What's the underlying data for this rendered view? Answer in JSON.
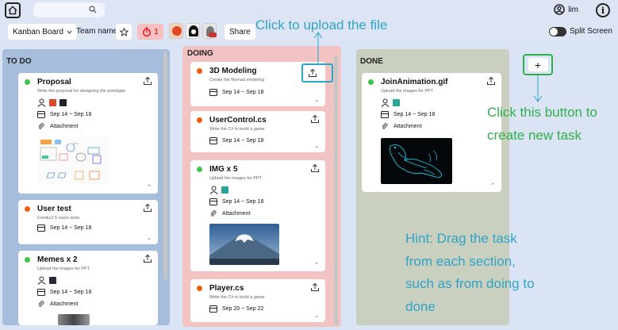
{
  "topbar": {
    "user_name": "lim",
    "info_symbol": "i"
  },
  "toolbar": {
    "board_select": "Kanban Board",
    "team_name": "Team name",
    "star_icon": "star-outline-icon",
    "timer_count": "1",
    "share_label": "Share",
    "split_screen_label": "Split Screen"
  },
  "columns": {
    "todo": {
      "title": "TO DO",
      "cards": [
        {
          "title": "Proposal",
          "desc": "Write the proposal for designing the prototype",
          "dates": "Sep 14 ~ Sep 18",
          "attachment": "Attachment",
          "status_color": "#3cc44b"
        },
        {
          "title": "User test",
          "desc": "Conduct 5 users tests",
          "dates": "Sep 14 ~ Sep 18",
          "status_color": "#f05a0b"
        },
        {
          "title": "Memes x 2",
          "desc": "Upload the images for PPT",
          "dates": "Sep 14 ~ Sep 18",
          "attachment": "Attachment",
          "status_color": "#3cc44b"
        }
      ]
    },
    "doing": {
      "title": "DOING",
      "cards": [
        {
          "title": "3D Modeling",
          "desc": "Create the Nomad modeling",
          "dates": "Sep 14 ~ Sep 18",
          "status_color": "#f05a0b"
        },
        {
          "title": "UserControl.cs",
          "desc": "Write the C# to build a game",
          "dates": "Sep 14 ~ Sep 18",
          "status_color": "#f05a0b"
        },
        {
          "title": "IMG x 5",
          "desc": "Upload the images for PPT",
          "dates": "Sep 14 ~ Sep 18",
          "attachment": "Attachment",
          "status_color": "#3cc44b"
        },
        {
          "title": "Player.cs",
          "desc": "Write the C# to build a game",
          "dates": "Sep 20 ~ Sep 22",
          "status_color": "#f05a0b"
        }
      ]
    },
    "done": {
      "title": "DONE",
      "cards": [
        {
          "title": "JoinAnimation.gif",
          "desc": "Upload the images for PPT",
          "dates": "Sep 14 ~ Sep 18",
          "attachment": "Attachment",
          "status_color": "#3cc44b"
        }
      ]
    }
  },
  "add_task_symbol": "+",
  "annotations": {
    "upload_hint": "Click to upload the file",
    "create_hint_line1": "Click this button to",
    "create_hint_line2": "create new task",
    "drag_hint_line1": "Hint: Drag the task",
    "drag_hint_line2": "from each section,",
    "drag_hint_line3": "such as from doing to",
    "drag_hint_line4": "done"
  },
  "colors": {
    "todo_bg": "#a6bedc",
    "doing_bg": "#f2c3c3",
    "done_bg": "#c9d0bf",
    "annotation_blue": "#2fa3c8",
    "annotation_green": "#2fb04a"
  }
}
